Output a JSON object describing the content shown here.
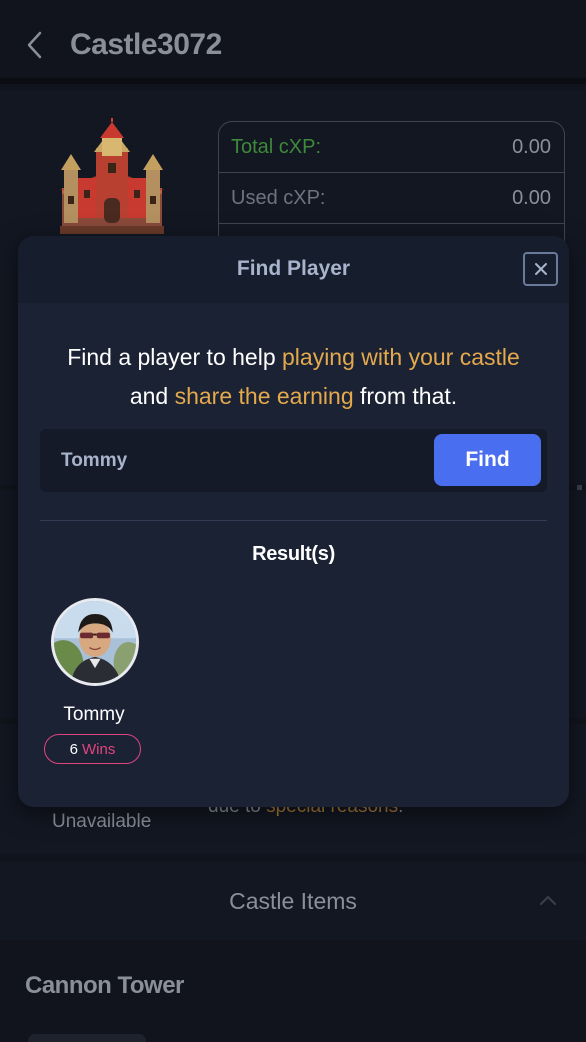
{
  "header": {
    "title": "Castle3072"
  },
  "castle": {
    "stats": [
      {
        "label": "Total cXP:",
        "value": "0.00"
      },
      {
        "label": "Used cXP:",
        "value": "0.00"
      }
    ],
    "status": "Unavailable",
    "reason_prefix": "due to ",
    "reason_highlight": "special reasons",
    "reason_suffix": "."
  },
  "castle_items": {
    "title": "Castle Items",
    "first_item": "Cannon Tower"
  },
  "modal": {
    "title": "Find Player",
    "desc_part1": "Find a player to help ",
    "desc_highlight1": "playing with your castle",
    "desc_part2": "and ",
    "desc_highlight2": "share the earning",
    "desc_part3": " from that.",
    "search_value": "Tommy",
    "find_label": "Find",
    "results_title": "Result(s)",
    "results": [
      {
        "name": "Tommy",
        "wins_count": "6",
        "wins_label": "Wins"
      }
    ]
  },
  "colors": {
    "accent_orange": "#e4a94c",
    "primary_blue": "#4a6ef0",
    "wins_pink": "#e0457e",
    "green_label": "#3d8a3a"
  }
}
